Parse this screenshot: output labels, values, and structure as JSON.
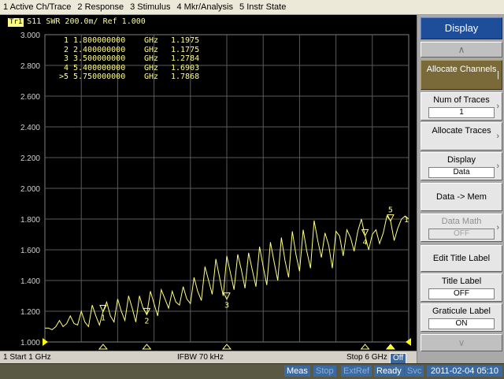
{
  "menu": [
    "1 Active Ch/Trace",
    "2 Response",
    "3 Stimulus",
    "4 Mkr/Analysis",
    "5 Instr State"
  ],
  "trace_header": {
    "badge": "Tr1",
    "text": "S11  SWR 200.0m/ Ref 1.000"
  },
  "markers": [
    {
      "id": "1",
      "freq": "1.800000000",
      "unit": "GHz",
      "value": "1.1975"
    },
    {
      "id": "2",
      "freq": "2.400000000",
      "unit": "GHz",
      "value": "1.1775"
    },
    {
      "id": "3",
      "freq": "3.500000000",
      "unit": "GHz",
      "value": "1.2784"
    },
    {
      "id": "4",
      "freq": "5.400000000",
      "unit": "GHz",
      "value": "1.6903"
    },
    {
      "id": ">5",
      "freq": "5.750000000",
      "unit": "GHz",
      "value": "1.7868"
    }
  ],
  "status_line": {
    "start": "1  Start 1 GHz",
    "ifbw": "IFBW 70 kHz",
    "stop": "Stop 6 GHz",
    "off": "Off"
  },
  "softkeys": {
    "display": "Display",
    "up_arrow": "∧",
    "allocate_channels": "Allocate Channels",
    "num_traces_label": "Num of Traces",
    "num_traces_value": "1",
    "allocate_traces": "Allocate Traces",
    "display_label": "Display",
    "display_value": "Data",
    "data_mem": "Data -> Mem",
    "data_math_label": "Data Math",
    "data_math_value": "OFF",
    "edit_title": "Edit Title Label",
    "title_label": "Title Label",
    "title_label_value": "OFF",
    "graticule_label": "Graticule Label",
    "graticule_label_value": "ON",
    "down_arrow": "∨"
  },
  "status_bar": {
    "meas": "Meas",
    "stop": "Stop",
    "extref": "ExtRef",
    "ready": "Ready",
    "svc": "Svc",
    "datetime": "2011-02-04 05:10"
  },
  "colors": {
    "trace": "#ffff80",
    "grid": "#5a5a5a",
    "background": "#000000",
    "accent": "#1e4e9a"
  },
  "chart_data": {
    "type": "line",
    "title": "S11 SWR 200.0m/ Ref 1.000",
    "xlabel": "",
    "ylabel": "",
    "xlim": [
      1,
      6
    ],
    "x_unit": "GHz",
    "ylim": [
      1.0,
      3.0
    ],
    "y_ticks": [
      "3.000",
      "2.800",
      "2.600",
      "2.400",
      "2.200",
      "2.000",
      "1.800",
      "1.600",
      "1.400",
      "1.200",
      "1.000"
    ],
    "grid": true,
    "series": [
      {
        "x": [
          1.0,
          1.05,
          1.1,
          1.15,
          1.2,
          1.25,
          1.3,
          1.35,
          1.4,
          1.45,
          1.5,
          1.55,
          1.6,
          1.65,
          1.7,
          1.75,
          1.8,
          1.85,
          1.9,
          1.95,
          2.0,
          2.05,
          2.1,
          2.15,
          2.2,
          2.25,
          2.3,
          2.35,
          2.4,
          2.45,
          2.5,
          2.55,
          2.6,
          2.65,
          2.7,
          2.75,
          2.8,
          2.85,
          2.9,
          2.95,
          3.0,
          3.05,
          3.1,
          3.15,
          3.2,
          3.25,
          3.3,
          3.35,
          3.4,
          3.45,
          3.5,
          3.55,
          3.6,
          3.65,
          3.7,
          3.75,
          3.8,
          3.85,
          3.9,
          3.95,
          4.0,
          4.05,
          4.1,
          4.15,
          4.2,
          4.25,
          4.3,
          4.35,
          4.4,
          4.45,
          4.5,
          4.55,
          4.6,
          4.65,
          4.7,
          4.75,
          4.8,
          4.85,
          4.9,
          4.95,
          5.0,
          5.05,
          5.1,
          5.15,
          5.2,
          5.25,
          5.3,
          5.35,
          5.4,
          5.45,
          5.5,
          5.55,
          5.6,
          5.65,
          5.7,
          5.75,
          5.8,
          5.85,
          5.9,
          5.95,
          6.0
        ],
        "values": [
          1.09,
          1.09,
          1.08,
          1.1,
          1.14,
          1.1,
          1.12,
          1.17,
          1.12,
          1.11,
          1.2,
          1.13,
          1.1,
          1.24,
          1.17,
          1.11,
          1.2,
          1.26,
          1.17,
          1.13,
          1.28,
          1.2,
          1.14,
          1.3,
          1.22,
          1.13,
          1.3,
          1.22,
          1.18,
          1.33,
          1.25,
          1.17,
          1.34,
          1.28,
          1.22,
          1.33,
          1.26,
          1.24,
          1.36,
          1.28,
          1.25,
          1.42,
          1.33,
          1.27,
          1.49,
          1.4,
          1.31,
          1.54,
          1.42,
          1.3,
          1.56,
          1.45,
          1.34,
          1.57,
          1.47,
          1.35,
          1.58,
          1.47,
          1.36,
          1.62,
          1.49,
          1.37,
          1.65,
          1.52,
          1.4,
          1.68,
          1.53,
          1.42,
          1.72,
          1.57,
          1.46,
          1.73,
          1.59,
          1.48,
          1.79,
          1.66,
          1.55,
          1.71,
          1.63,
          1.48,
          1.72,
          1.69,
          1.56,
          1.73,
          1.68,
          1.59,
          1.72,
          1.8,
          1.69,
          1.6,
          1.7,
          1.73,
          1.64,
          1.71,
          1.82,
          1.79,
          1.66,
          1.74,
          1.8,
          1.82,
          1.8
        ]
      }
    ],
    "marker_points": [
      {
        "label": "1",
        "x": 1.8,
        "y": 1.1975
      },
      {
        "label": "2",
        "x": 2.4,
        "y": 1.1775
      },
      {
        "label": "3",
        "x": 3.5,
        "y": 1.2784
      },
      {
        "label": "4",
        "x": 5.4,
        "y": 1.6903
      },
      {
        "label": "5",
        "x": 5.75,
        "y": 1.7868
      }
    ],
    "end_marker_label": "1"
  }
}
